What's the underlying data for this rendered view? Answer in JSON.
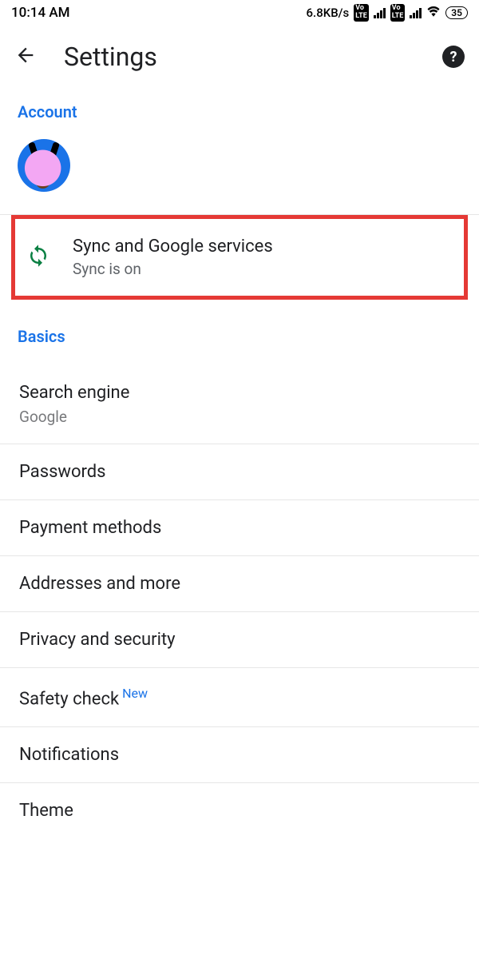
{
  "status": {
    "time": "10:14 AM",
    "net_speed": "6.8KB/s",
    "volte1": "Vo LTE",
    "volte2": "Vo LTE",
    "battery": "35"
  },
  "header": {
    "title": "Settings"
  },
  "account": {
    "label": "Account"
  },
  "sync": {
    "title": "Sync and Google services",
    "subtitle": "Sync is on"
  },
  "basics": {
    "label": "Basics",
    "items": [
      {
        "title": "Search engine",
        "subtitle": "Google"
      },
      {
        "title": "Passwords"
      },
      {
        "title": "Payment methods"
      },
      {
        "title": "Addresses and more"
      },
      {
        "title": "Privacy and security"
      },
      {
        "title": "Safety check",
        "badge": "New"
      },
      {
        "title": "Notifications"
      },
      {
        "title": "Theme"
      }
    ]
  }
}
